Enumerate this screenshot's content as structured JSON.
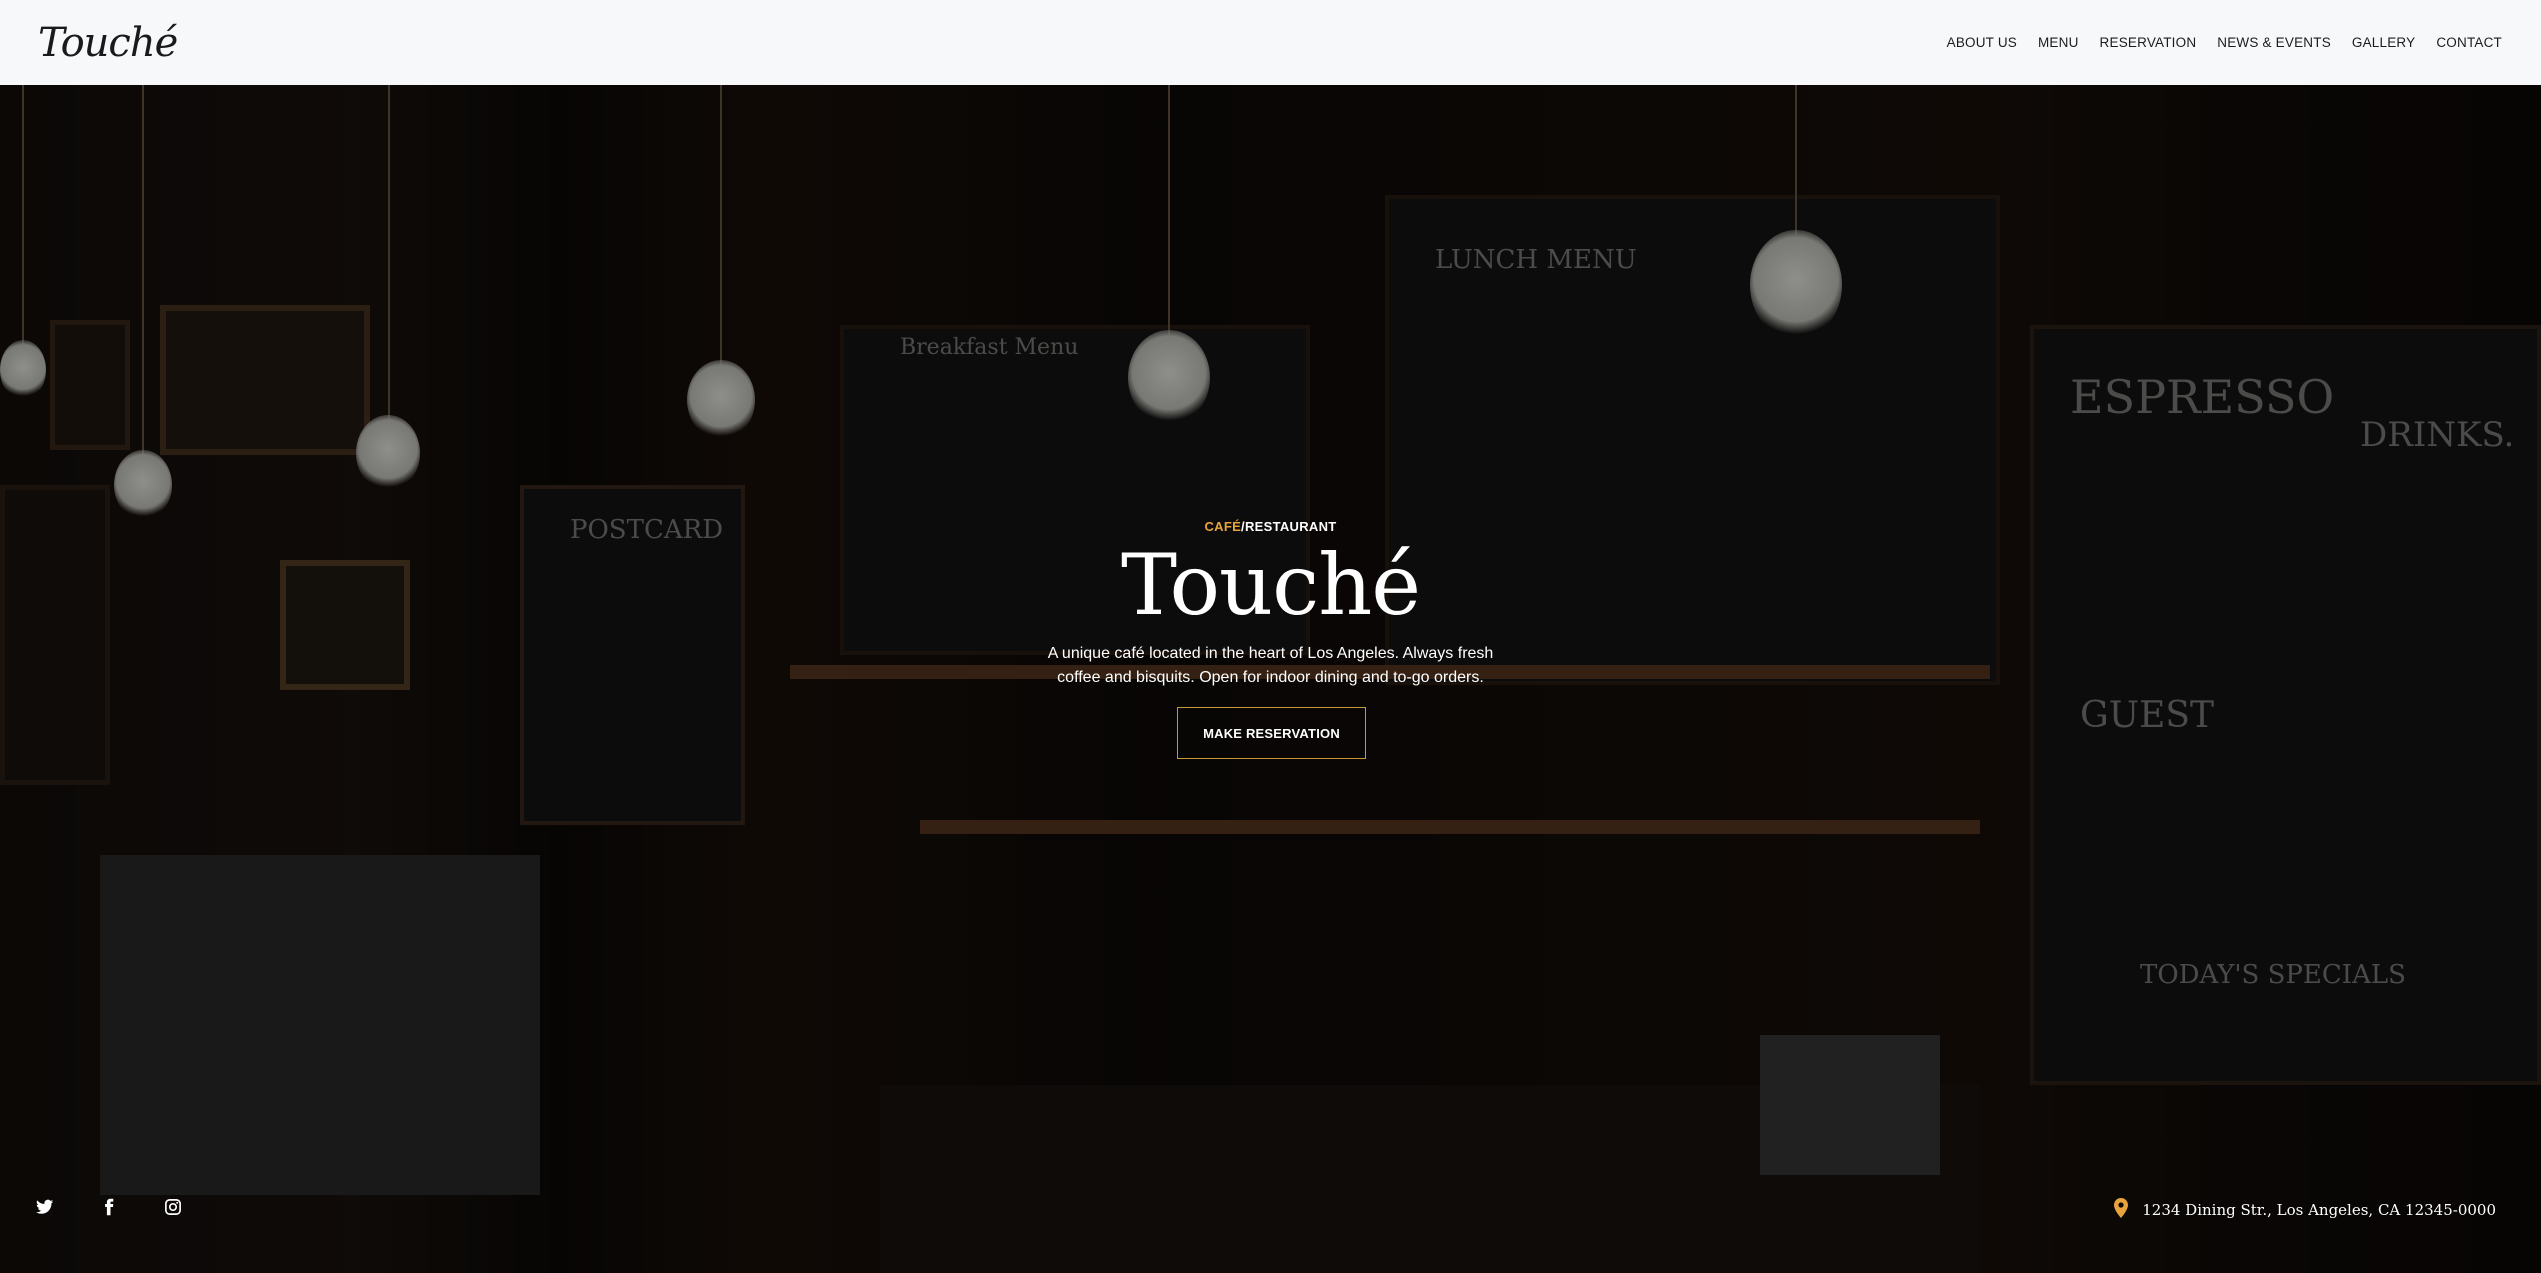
{
  "brand": {
    "name": "Touché"
  },
  "nav": {
    "items": [
      {
        "label": "ABOUT US"
      },
      {
        "label": "MENU"
      },
      {
        "label": "RESERVATION"
      },
      {
        "label": "NEWS & EVENTS"
      },
      {
        "label": "GALLERY"
      },
      {
        "label": "CONTACT"
      }
    ]
  },
  "hero": {
    "tagline_accent": "CAFÉ",
    "tagline_rest": "/RESTAURANT",
    "title": "Touché",
    "description": "A unique café located in the heart of Los Angeles. Always fresh coffee and bisquits. Open for indoor dining and to-go orders.",
    "cta_label": "MAKE RESERVATION",
    "background_image": "dim cafe interior with chalkboard menus and pendant bulbs"
  },
  "footer": {
    "social_icons": [
      "twitter-icon",
      "facebook-icon",
      "instagram-icon"
    ],
    "address": "1234 Dining Str., Los Angeles, CA 12345-0000"
  },
  "colors": {
    "accent": "#e8a33c",
    "cta_border": "#c9963a",
    "nav_bg": "#f6f8fa",
    "text_on_dark": "#ffffff"
  }
}
